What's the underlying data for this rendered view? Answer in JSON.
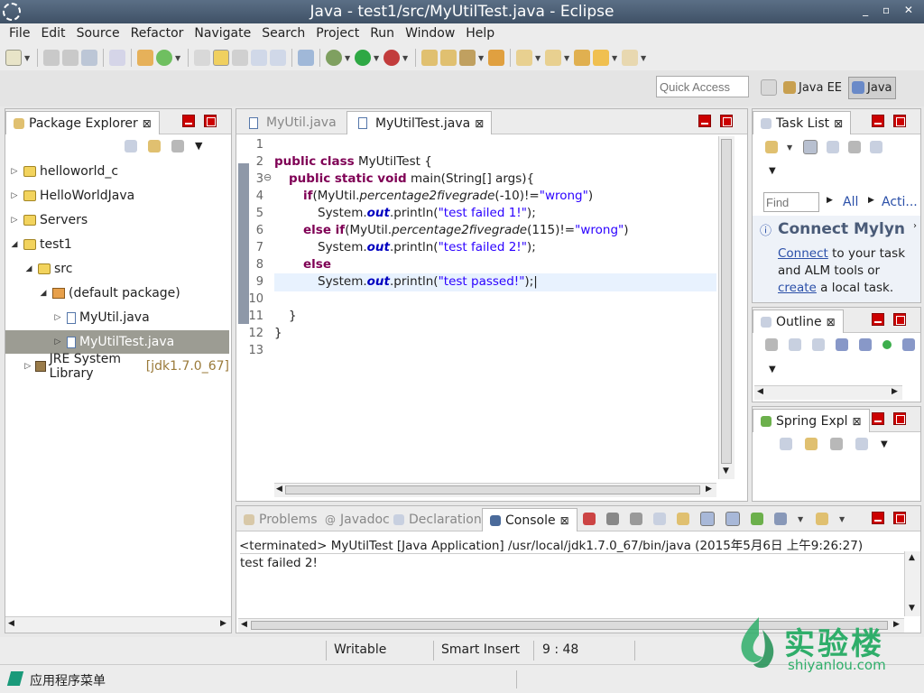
{
  "window": {
    "title": "Java - test1/src/MyUtilTest.java - Eclipse",
    "controls": "_ ▫ ✕"
  },
  "menu": [
    "File",
    "Edit",
    "Source",
    "Refactor",
    "Navigate",
    "Search",
    "Project",
    "Run",
    "Window",
    "Help"
  ],
  "quick_access": {
    "placeholder": "Quick Access"
  },
  "perspectives": [
    "Java EE",
    "Java"
  ],
  "package_explorer": {
    "title": "Package Explorer",
    "items": [
      {
        "label": "helloworld_c",
        "arrow": "▷",
        "icon": "folder"
      },
      {
        "label": "HelloWorldJava",
        "arrow": "▷",
        "icon": "folder"
      },
      {
        "label": "Servers",
        "arrow": "▷",
        "icon": "folder"
      },
      {
        "label": "test1",
        "arrow": "◢",
        "icon": "folder"
      },
      {
        "label": "src",
        "arrow": "◢",
        "icon": "folder"
      },
      {
        "label": "(default package)",
        "arrow": "◢",
        "icon": "package"
      },
      {
        "label": "MyUtil.java",
        "arrow": "▷",
        "icon": "java-file"
      },
      {
        "label": "MyUtilTest.java",
        "arrow": "▷",
        "icon": "java-file"
      },
      {
        "label": "JRE System Library",
        "suffix": "[jdk1.7.0_67]",
        "arrow": "▷",
        "icon": "library"
      }
    ]
  },
  "editor": {
    "tabs": [
      "MyUtil.java",
      "MyUtilTest.java"
    ],
    "line_numbers": [
      "1",
      "2",
      "3",
      "4",
      "5",
      "6",
      "7",
      "8",
      "9",
      "10",
      "11",
      "12",
      "13"
    ],
    "fold_marker": "⊖"
  },
  "task_list": {
    "title": "Task List",
    "find_placeholder": "Find",
    "filters": [
      "All",
      "Acti..."
    ],
    "connect_title": "Connect Mylyn",
    "connect_link": "Connect",
    "connect_text1": " to your task and ALM tools or ",
    "create_link": "create",
    "connect_text2": " a local task."
  },
  "outline": {
    "title": "Outline"
  },
  "spring": {
    "title": "Spring Expl"
  },
  "bottom_tabs": [
    "Problems",
    "Javadoc",
    "Declaration",
    "Console"
  ],
  "console": {
    "header": "<terminated> MyUtilTest [Java Application] /usr/local/jdk1.7.0_67/bin/java (2015年5月6日 上午9:26:27)",
    "output": "test failed 2!"
  },
  "status": {
    "writable": "Writable",
    "insert": "Smart Insert",
    "position": "9 : 48"
  },
  "taskbar": {
    "apps_menu": "应用程序菜单"
  },
  "watermark": {
    "brand_cn": "实验楼",
    "brand_url": "shiyanlou.com"
  }
}
